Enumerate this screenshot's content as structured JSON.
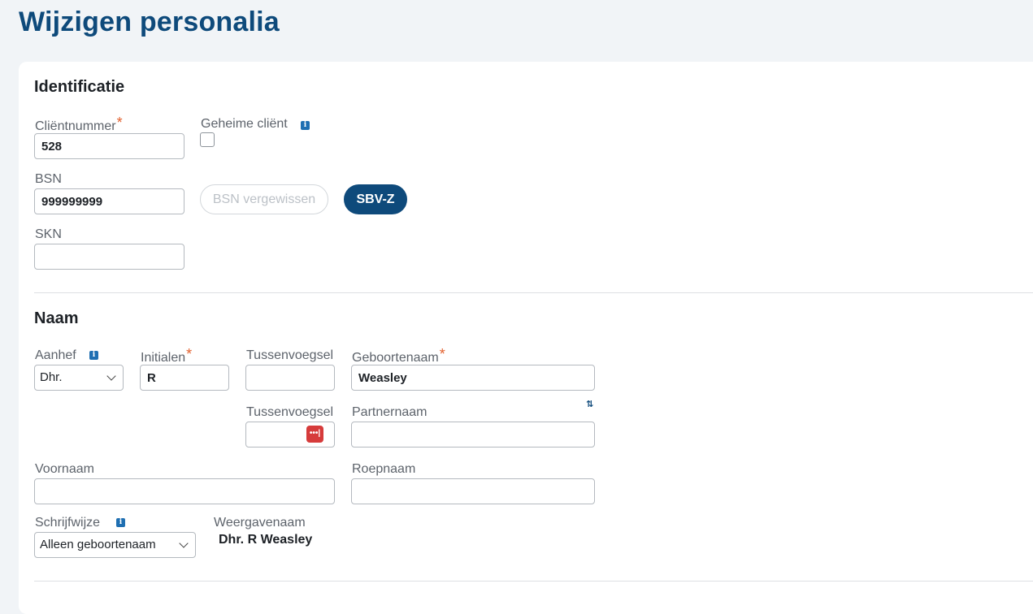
{
  "page": {
    "title": "Wijzigen personalia"
  },
  "identificatie": {
    "title": "Identificatie",
    "clientnummer": {
      "label": "Cliëntnummer",
      "required": "*",
      "value": "528"
    },
    "geheime_client": {
      "label": "Geheime cliënt",
      "info": "i",
      "checked": false
    },
    "bsn": {
      "label": "BSN",
      "value": "999999999"
    },
    "bsn_vergewissen_label": "BSN vergewissen",
    "sbvz_label": "SBV-Z",
    "skn": {
      "label": "SKN",
      "value": ""
    }
  },
  "naam": {
    "title": "Naam",
    "aanhef": {
      "label": "Aanhef",
      "info": "i",
      "value": "Dhr."
    },
    "initialen": {
      "label": "Initialen",
      "required": "*",
      "value": "R"
    },
    "tussenvoegsel1": {
      "label": "Tussenvoegsel",
      "value": ""
    },
    "geboortenaam": {
      "label": "Geboortenaam",
      "required": "*",
      "value": "Weasley"
    },
    "swap_icon": "⇅",
    "tussenvoegsel2": {
      "label": "Tussenvoegsel",
      "value": "",
      "icon": "•••|"
    },
    "partnernaam": {
      "label": "Partnernaam",
      "value": ""
    },
    "voornaam": {
      "label": "Voornaam",
      "value": ""
    },
    "roepnaam": {
      "label": "Roepnaam",
      "value": ""
    },
    "schrijfwijze": {
      "label": "Schrijfwijze",
      "info": "i",
      "value": "Alleen geboortenaam"
    },
    "weergavenaam": {
      "label": "Weergavenaam",
      "value": "Dhr. R Weasley"
    }
  },
  "colors": {
    "brand": "#0e4a7b",
    "required": "#e2612f",
    "info": "#1f6fb2",
    "password_icon": "#d63b3b"
  }
}
